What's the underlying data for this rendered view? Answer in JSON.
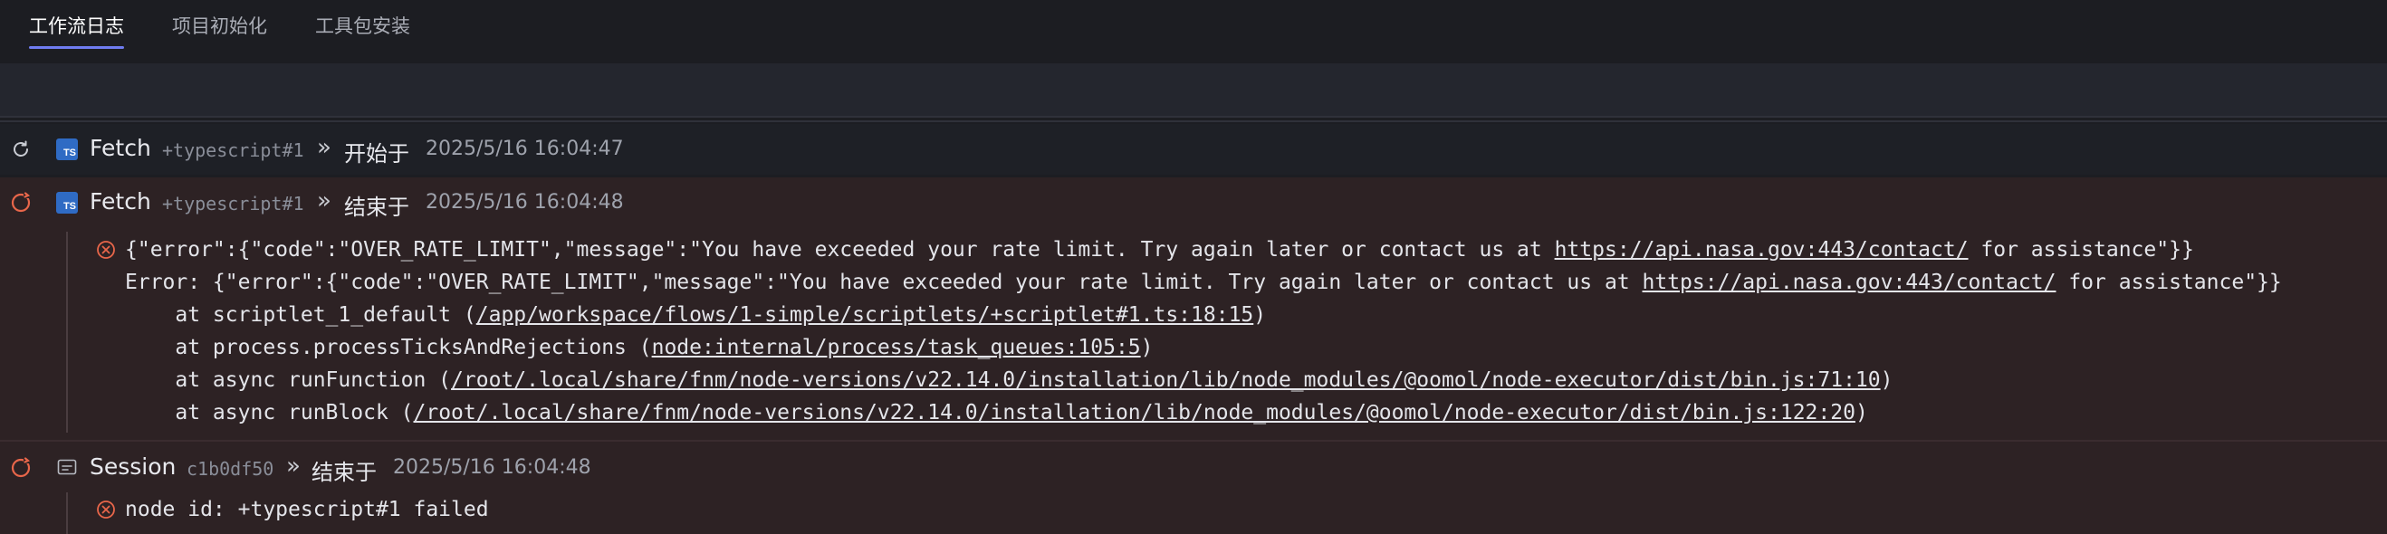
{
  "tabs": [
    {
      "label": "工作流日志",
      "active": true
    },
    {
      "label": "项目初始化",
      "active": false
    },
    {
      "label": "工具包安装",
      "active": false
    }
  ],
  "entries": [
    {
      "status_icon": "refresh-icon",
      "badge": "TS",
      "name": "Fetch",
      "id": "+typescript#1",
      "arrow": "»",
      "verb": "开始于",
      "time": "2025/5/16 16:04:47"
    },
    {
      "status_icon": "retry-icon",
      "badge": "TS",
      "name": "Fetch",
      "id": "+typescript#1",
      "arrow": "»",
      "verb": "结束于",
      "time": "2025/5/16 16:04:48",
      "error": {
        "l1_pre": "{\"error\":{\"code\":\"OVER_RATE_LIMIT\",\"message\":\"You have exceeded your rate limit. Try again later or contact us at ",
        "l1_link": "https://api.nasa.gov:443/contact/",
        "l1_post": " for assistance\"}}",
        "l2_pre": "Error: {\"error\":{\"code\":\"OVER_RATE_LIMIT\",\"message\":\"You have exceeded your rate limit. Try again later or contact us at ",
        "l2_link": "https://api.nasa.gov:443/contact/",
        "l2_post": " for assistance\"}}",
        "l3_pre": "    at scriptlet_1_default (",
        "l3_link": "/app/workspace/flows/1-simple/scriptlets/+scriptlet#1.ts:18:15",
        "l3_post": ")",
        "l4_pre": "    at process.processTicksAndRejections (",
        "l4_link": "node:internal/process/task_queues:105:5",
        "l4_post": ")",
        "l5_pre": "    at async runFunction (",
        "l5_link": "/root/.local/share/fnm/node-versions/v22.14.0/installation/lib/node_modules/@oomol/node-executor/dist/bin.js:71:10",
        "l5_post": ")",
        "l6_pre": "    at async runBlock (",
        "l6_link": "/root/.local/share/fnm/node-versions/v22.14.0/installation/lib/node_modules/@oomol/node-executor/dist/bin.js:122:20",
        "l6_post": ")"
      }
    },
    {
      "status_icon": "retry-icon",
      "name": "Session",
      "id": "c1b0df50",
      "arrow": "»",
      "verb": "结束于",
      "time": "2025/5/16 16:04:48",
      "message": "node id: +typescript#1 failed"
    }
  ],
  "colors": {
    "accent": "#6f7cf0",
    "error": "#e8664a",
    "ts_badge": "#2f6bc4"
  }
}
